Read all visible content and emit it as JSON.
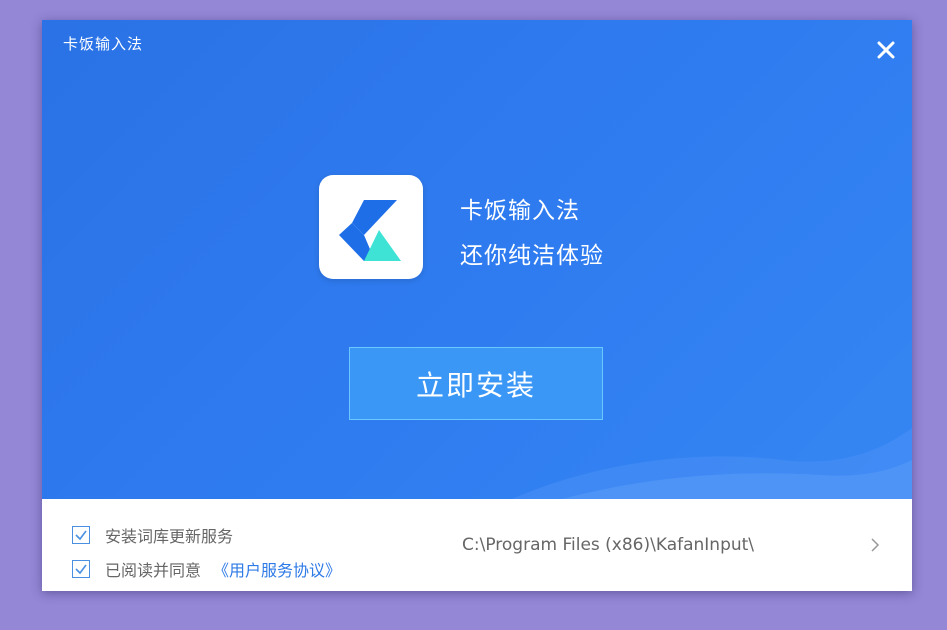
{
  "window": {
    "title": "卡饭输入法"
  },
  "hero": {
    "app_name": "卡饭输入法",
    "slogan": "还你纯洁体验",
    "install_button_label": "立即安装"
  },
  "footer": {
    "option_dict_update": {
      "label": "安装词库更新服务",
      "checked": true
    },
    "option_agree": {
      "label": "已阅读并同意",
      "checked": true,
      "link_text": "《用户服务协议》"
    },
    "install_path": "C:\\Program Files (x86)\\KafanInput\\"
  },
  "colors": {
    "hero_blue": "#2f7cf0",
    "button_blue": "#3a97f6",
    "link_blue": "#2e7ae6",
    "logo_blue": "#1e6ee8",
    "logo_cyan": "#3fe3d5"
  },
  "icons": {
    "close": "close-icon",
    "logo": "kafan-logo-icon",
    "check": "check-icon",
    "chevron": "chevron-right-icon"
  }
}
